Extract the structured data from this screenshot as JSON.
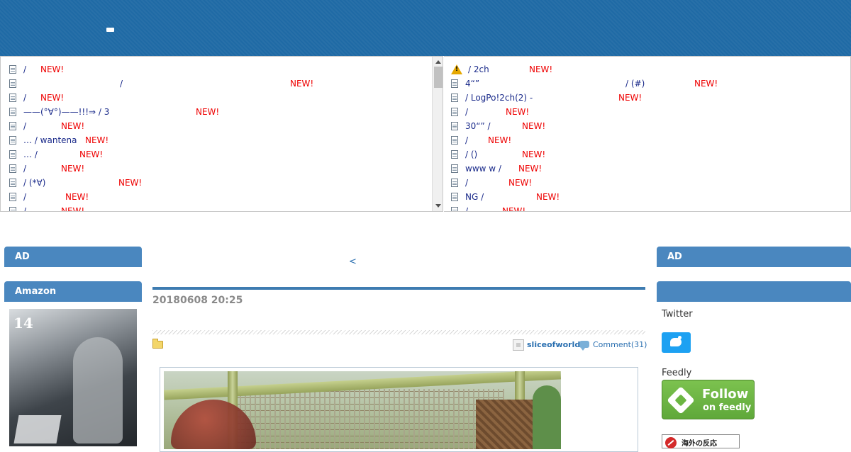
{
  "colors": {
    "header_bg": "#1f6aa5",
    "accent_blue": "#4a87bf",
    "new_red": "#e00000",
    "link_blue": "#2a6fb0"
  },
  "feed_left": {
    "items": [
      {
        "title": "/",
        "badge": "NEW!"
      },
      {
        "title": "/",
        "badge": "NEW!"
      },
      {
        "title": "/",
        "badge": "NEW!"
      },
      {
        "title": "——(°∀°)——!!!⇒ / 3",
        "badge": "NEW!"
      },
      {
        "title": "/",
        "badge": "NEW!"
      },
      {
        "title": "… / wantena",
        "badge": "NEW!"
      },
      {
        "title": "… /",
        "badge": "NEW!"
      },
      {
        "title": "/",
        "badge": "NEW!"
      },
      {
        "title": "/ (*∀)",
        "badge": "NEW!"
      },
      {
        "title": "/",
        "badge": "NEW!"
      },
      {
        "title": "/",
        "badge": "NEW!"
      }
    ]
  },
  "feed_right": {
    "items": [
      {
        "title": "/ 2ch",
        "badge": "NEW!"
      },
      {
        "title": "4“”",
        "title2": "/ (#)",
        "badge": "NEW!"
      },
      {
        "title": "/ LogPo!2ch(2) -",
        "badge": "NEW!"
      },
      {
        "title": "/",
        "badge": "NEW!"
      },
      {
        "title": "30“” /",
        "badge": "NEW!"
      },
      {
        "title": "/",
        "badge": "NEW!"
      },
      {
        "title": "/ ()",
        "badge": "NEW!"
      },
      {
        "title": "www w /",
        "badge": "NEW!"
      },
      {
        "title": "/",
        "badge": "NEW!"
      },
      {
        "title": "NG /",
        "badge": "NEW!"
      },
      {
        "title": "/",
        "badge": "NEW!"
      }
    ]
  },
  "left_sidebar": {
    "ad_title": "AD",
    "amazon_title": "Amazon",
    "book_volume": "14"
  },
  "post": {
    "prev_link": "<",
    "date": "20180608 20:25",
    "author": "sliceofworld",
    "comments": "Comment(31)"
  },
  "right_sidebar": {
    "ad_title": "AD",
    "twitter_label": "Twitter",
    "feedly_label": "Feedly",
    "feedly_follow": "Follow",
    "feedly_on": "on feedly",
    "kaigai_text": "海外の反応"
  },
  "icons": [
    "doc-icon",
    "warning-icon",
    "folder-icon",
    "author-icon",
    "comment-icon",
    "twitter-bird-icon",
    "feedly-logo-icon",
    "scroll-up-icon",
    "scroll-down-icon"
  ]
}
